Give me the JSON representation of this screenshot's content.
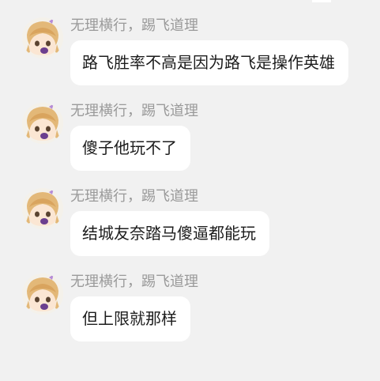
{
  "conversation": {
    "messages": [
      {
        "sender": "无理横行，踢飞道理",
        "text": "路飞胜率不高是因为路飞是操作英雄"
      },
      {
        "sender": "无理横行，踢飞道理",
        "text": "傻子他玩不了"
      },
      {
        "sender": "无理横行，踢飞道理",
        "text": "结城友奈踏马傻逼都能玩"
      },
      {
        "sender": "无理横行，踢飞道理",
        "text": "但上限就那样"
      }
    ]
  },
  "theme": {
    "background": "#f1f1f1",
    "bubble": "#ffffff",
    "sender_color": "#9a9a9a",
    "text_color": "#1c1c1c"
  },
  "icons": {
    "avatar": "anime-girl-avatar"
  }
}
